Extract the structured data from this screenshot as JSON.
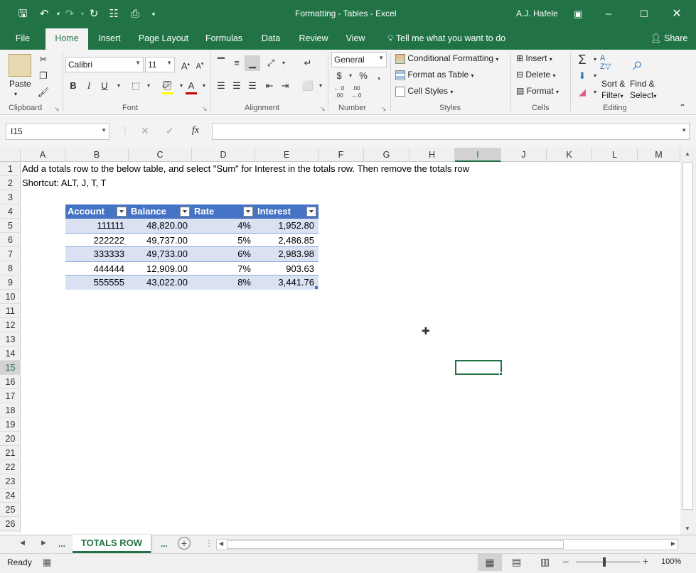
{
  "window": {
    "title": "Formatting - Tables  -  Excel",
    "user": "A.J. Hafele"
  },
  "ribbon_tabs": [
    "File",
    "Home",
    "Insert",
    "Page Layout",
    "Formulas",
    "Data",
    "Review",
    "View"
  ],
  "tell_me": "Tell me what you want to do",
  "share": "Share",
  "clipboard": {
    "paste": "Paste",
    "label": "Clipboard"
  },
  "font": {
    "name": "Calibri",
    "size": "11",
    "label": "Font",
    "bold": "B",
    "italic": "I",
    "underline": "U"
  },
  "alignment": {
    "label": "Alignment"
  },
  "number": {
    "format": "General",
    "label": "Number",
    "currency": "$",
    "percent": "%",
    "comma": ","
  },
  "styles": {
    "conditional": "Conditional Formatting",
    "format_table": "Format as Table",
    "cell_styles": "Cell Styles",
    "label": "Styles"
  },
  "cells_group": {
    "insert": "Insert",
    "delete": "Delete",
    "format": "Format",
    "label": "Cells"
  },
  "editing": {
    "sort": "Sort &",
    "filter": "Filter",
    "find": "Find &",
    "select": "Select",
    "label": "Editing"
  },
  "name_box": "I15",
  "fx": "fx",
  "columns": [
    "A",
    "B",
    "C",
    "D",
    "E",
    "F",
    "G",
    "H",
    "I",
    "J",
    "K",
    "L",
    "M"
  ],
  "rows": [
    "1",
    "2",
    "3",
    "4",
    "5",
    "6",
    "7",
    "8",
    "9",
    "10",
    "11",
    "12",
    "13",
    "14",
    "15",
    "16",
    "17",
    "18",
    "19",
    "20",
    "21",
    "22",
    "23",
    "24",
    "25",
    "26"
  ],
  "instructions": {
    "line1": "Add a totals row to the below table, and select \"Sum\" for Interest in the totals row.  Then remove the totals row",
    "line2": "Shortcut: ALT, J, T, T"
  },
  "table": {
    "headers": [
      "Account",
      "Balance",
      "Rate",
      "Interest"
    ],
    "rows": [
      [
        "111111",
        "48,820.00",
        "4%",
        "1,952.80"
      ],
      [
        "222222",
        "49,737.00",
        "5%",
        "2,486.85"
      ],
      [
        "333333",
        "49,733.00",
        "6%",
        "2,983.98"
      ],
      [
        "444444",
        "12,909.00",
        "7%",
        "903.63"
      ],
      [
        "555555",
        "43,022.00",
        "8%",
        "3,441.76"
      ]
    ]
  },
  "sheet_tabs": {
    "active": "TOTALS ROW",
    "more": "..."
  },
  "status": {
    "ready": "Ready",
    "zoom": "100%"
  },
  "colors": {
    "excel_green": "#217346",
    "table_header": "#4472c4",
    "table_band": "#d9e1f2"
  }
}
